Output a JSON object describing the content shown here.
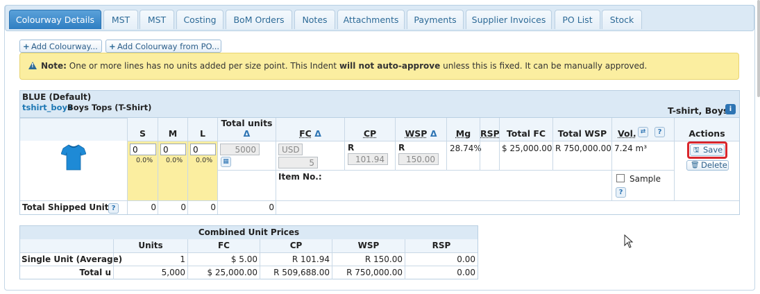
{
  "tabs": [
    {
      "label": "Colourway Details",
      "active": true
    },
    {
      "label": "MST"
    },
    {
      "label": "MST"
    },
    {
      "label": "Costing"
    },
    {
      "label": "BoM Orders"
    },
    {
      "label": "Notes"
    },
    {
      "label": "Attachments"
    },
    {
      "label": "Payments"
    },
    {
      "label": "Supplier Invoices"
    },
    {
      "label": "PO List"
    },
    {
      "label": "Stock"
    }
  ],
  "toolbar": {
    "add_colourway": "Add Colourway...",
    "add_colourway_from_po": "Add Colourway from PO..."
  },
  "note": {
    "prefix": "Note:",
    "text1": "One or more lines has no units added per size point. This Indent",
    "bold": "will not auto-approve",
    "text2": "unless this is fixed. It can be manually approved."
  },
  "colourway": {
    "name": "BLUE (Default)",
    "code": "tshirt_boys",
    "description": "Boys Tops (T-Shirt)",
    "category": "T-shirt, Boys",
    "headers": {
      "s": "S",
      "m": "M",
      "l": "L",
      "total_units": "Total units",
      "delta": "Δ",
      "fc": "FC",
      "cp": "CP",
      "wsp": "WSP",
      "mg": "Mg",
      "rsp": "RSP",
      "total_fc": "Total FC",
      "total_wsp": "Total WSP",
      "vol": "Vol.",
      "actions": "Actions"
    },
    "sizes": {
      "s": {
        "value": "0",
        "pct": "0.0%"
      },
      "m": {
        "value": "0",
        "pct": "0.0%"
      },
      "l": {
        "value": "0",
        "pct": "0.0%"
      }
    },
    "total_units": "5000",
    "fc_currency": "USD",
    "fc_value": "5",
    "cp_currency": "R",
    "cp_value": "101.94",
    "wsp_currency": "R",
    "wsp_value": "150.00",
    "mg": "28.74%",
    "total_fc": "$ 25,000.00",
    "total_wsp": "R 750,000.00",
    "vol": "7.24 m³",
    "save_label": "Save",
    "delete_label": "Delete",
    "item_no_label": "Item No.:",
    "sample_label": "Sample",
    "shipped": {
      "label": "Total Shipped Units",
      "s": "0",
      "m": "0",
      "l": "0",
      "total": "0"
    }
  },
  "combined": {
    "title": "Combined Unit Prices",
    "headers": [
      "Units",
      "FC",
      "CP",
      "WSP",
      "RSP"
    ],
    "rows": [
      {
        "label": "Single Unit (Average)",
        "values": [
          "1",
          "$ 5.00",
          "R 101.94",
          "R 150.00",
          "0.00"
        ]
      },
      {
        "label": "Total u",
        "values": [
          "5,000",
          "$ 25,000.00",
          "R 509,688.00",
          "R 750,000.00",
          "0.00"
        ]
      }
    ]
  },
  "colors": {
    "accent": "#2f7ec2",
    "note_bg": "#fbeea0",
    "highlight": "#d9262c",
    "tshirt": "#1e8ad6"
  }
}
